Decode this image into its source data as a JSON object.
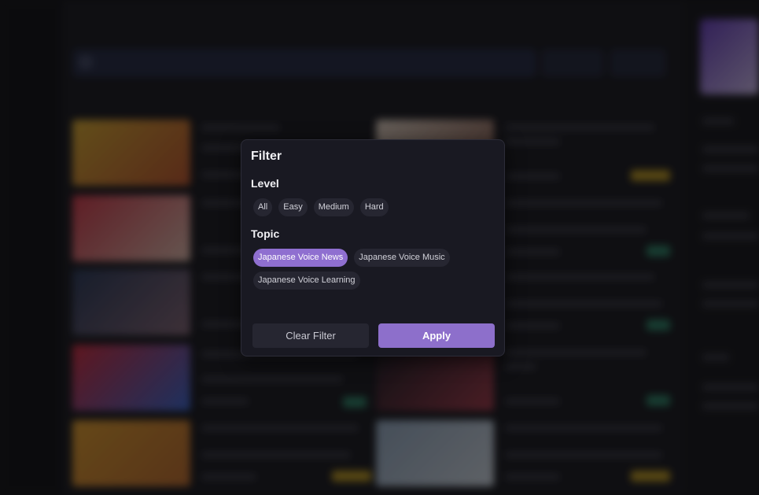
{
  "modal": {
    "title": "Filter",
    "level": {
      "heading": "Level",
      "options": [
        "All",
        "Easy",
        "Medium",
        "Hard"
      ],
      "selected": null
    },
    "topic": {
      "heading": "Topic",
      "options": [
        "Japanese Voice News",
        "Japanese Voice Music",
        "Japanese Voice Learning"
      ],
      "selected": "Japanese Voice News"
    },
    "clear_label": "Clear Filter",
    "apply_label": "Apply"
  },
  "colors": {
    "accent": "#8d6fcb",
    "modal_bg": "#191922",
    "chip_bg": "#262631"
  }
}
